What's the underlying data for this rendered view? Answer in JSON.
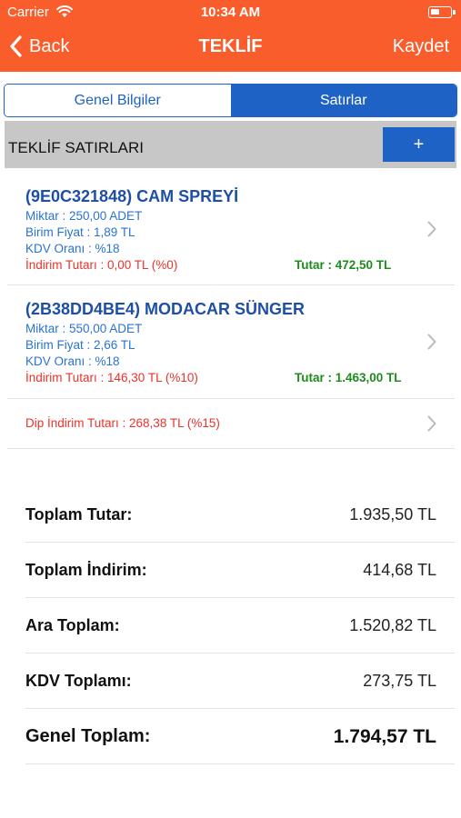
{
  "status_bar": {
    "carrier": "Carrier",
    "time": "10:34 AM"
  },
  "nav": {
    "back_label": "Back",
    "title": "TEKLİF",
    "save_label": "Kaydet",
    "color": "#f95d2b"
  },
  "tabs": [
    {
      "label": "Genel Bilgiler",
      "selected": false
    },
    {
      "label": "Satırlar",
      "selected": true
    }
  ],
  "section": {
    "title": "TEKLİF SATIRLARI",
    "add_label": "+"
  },
  "lines": [
    {
      "name": "(9E0C321848) CAM SPREYİ",
      "quantity": "Miktar : 250,00 ADET",
      "unit_price": "Birim Fiyat : 1,89 TL",
      "vat": "KDV Oranı : %18",
      "discount": "İndirim Tutarı : 0,00 TL (%0)",
      "total": "Tutar : 472,50 TL"
    },
    {
      "name": "(2B38DD4BE4) MODACAR SÜNGER",
      "quantity": "Miktar : 550,00 ADET",
      "unit_price": "Birim Fiyat : 2,66 TL",
      "vat": "KDV Oranı : %18",
      "discount": "İndirim Tutarı : 146,30 TL (%10)",
      "total": "Tutar : 1.463,00 TL"
    }
  ],
  "bottom_discount": "Dip İndirim Tutarı : 268,38 TL (%15)",
  "summary": [
    {
      "label": "Toplam Tutar:",
      "value": "1.935,50 TL"
    },
    {
      "label": "Toplam İndirim:",
      "value": "414,68 TL"
    },
    {
      "label": "Ara Toplam:",
      "value": "1.520,82 TL"
    },
    {
      "label": "KDV Toplamı:",
      "value": "273,75 TL"
    },
    {
      "label": "Genel Toplam:",
      "value": "1.794,57 TL"
    }
  ],
  "colors": {
    "accent_blue": "#1e62c6",
    "name_blue": "#1e4fa5",
    "meta_blue": "#2a73d1",
    "discount_red": "#e8332b",
    "total_green": "#1d8c1d"
  }
}
